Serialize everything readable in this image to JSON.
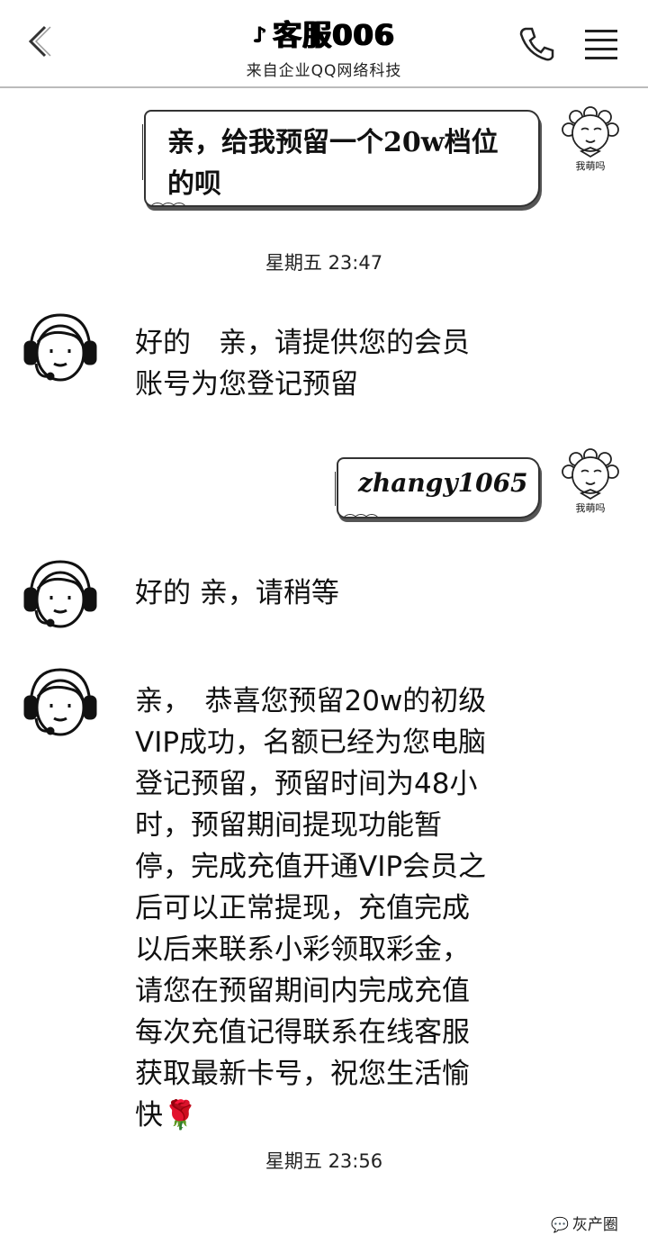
{
  "header": {
    "title": "客服006",
    "subtitle": "来自企业QQ网络科技"
  },
  "messages": {
    "m1": {
      "lines": [
        "亲，给我预留一个20w档位",
        "的呗"
      ],
      "caption": "我萌吗"
    },
    "ts1": "星期五 23:47",
    "m2": {
      "lines": [
        "好的　亲，请提供您的会员",
        "账号为您登记预留"
      ]
    },
    "m3": {
      "text": "zhangy1065",
      "caption": "我萌吗"
    },
    "m4": {
      "text": "好的  亲，请稍等"
    },
    "m5": {
      "lines": [
        "亲，　恭喜您预留20w的初级",
        "VIP成功，名额已经为您电脑",
        "登记预留，预留时间为48小",
        "时，预留期间提现功能暂",
        "停，完成充值开通VIP会员之",
        "后可以正常提现，充值完成",
        "以后来联系小彩领取彩金，",
        "请您在预留期间内完成充值",
        "每次充值记得联系在线客服",
        "获取最新卡号，祝您生活愉",
        "快🌹"
      ]
    },
    "ts2": "星期五 23:56"
  },
  "watermark": "灰产圈",
  "colors": {
    "background": "#ffffff",
    "text": "#111111",
    "divider": "#bbbbbb"
  }
}
